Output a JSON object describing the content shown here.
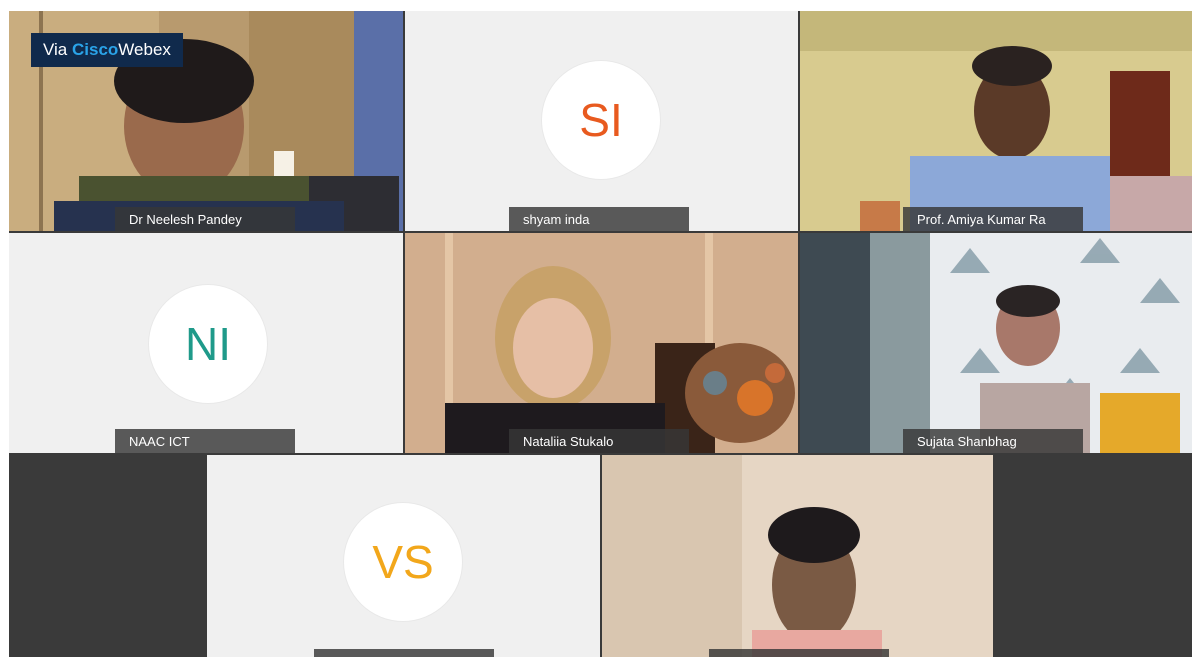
{
  "badge": {
    "via": "Via",
    "cisco": "Cisco",
    "webex": "Webex"
  },
  "participants": [
    {
      "name": "Dr Neelesh Pandey",
      "type": "video"
    },
    {
      "name": "shyam inda",
      "type": "avatar",
      "initials": "SI",
      "color": "#e85a1f"
    },
    {
      "name": "Prof. Amiya Kumar Ra",
      "type": "video"
    },
    {
      "name": "NAAC ICT",
      "type": "avatar",
      "initials": "NI",
      "color": "#1f9a8a"
    },
    {
      "name": "Nataliia Stukalo",
      "type": "video"
    },
    {
      "name": "Sujata Shanbhag",
      "type": "video"
    },
    {
      "name": "",
      "type": "avatar",
      "initials": "VS",
      "color": "#f2a71b"
    },
    {
      "name": "",
      "type": "video"
    }
  ]
}
